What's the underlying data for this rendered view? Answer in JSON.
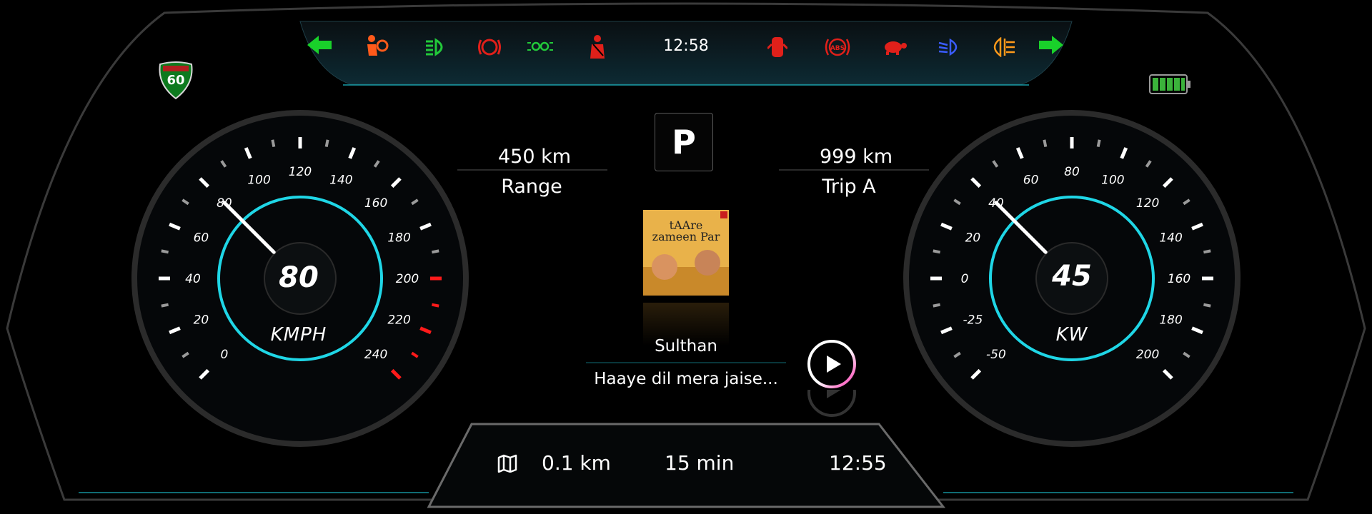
{
  "clock": "12:58",
  "speed_limit_sign": "60",
  "gear": "P",
  "range": {
    "value": "450 km",
    "label": "Range"
  },
  "trip": {
    "value": "999 km",
    "label": "Trip A"
  },
  "media": {
    "album_art_text": "tAAre zameen Par",
    "title": "Sulthan",
    "subtitle": "Haaye dil mera jaise..."
  },
  "speedometer": {
    "value": "80",
    "unit": "KMPH",
    "ticks": [
      "0",
      "20",
      "40",
      "60",
      "80",
      "100",
      "120",
      "140",
      "160",
      "180",
      "200",
      "220",
      "240"
    ],
    "redline_from": 200,
    "needle_value": 80
  },
  "power_meter": {
    "value": "45",
    "unit": "KW",
    "ticks": [
      "-50",
      "-25",
      "0",
      "20",
      "40",
      "60",
      "80",
      "100",
      "120",
      "140",
      "160",
      "180",
      "200"
    ],
    "needle_value": 40
  },
  "navigation": {
    "distance": "0.1 km",
    "duration": "15 min",
    "eta": "12:55"
  },
  "warning_icons": [
    {
      "name": "left-turn-signal-icon",
      "color": "#19d12a"
    },
    {
      "name": "airbag-warning-icon",
      "color": "#ff5a1a"
    },
    {
      "name": "high-beam-auto-icon",
      "color": "#22c93a"
    },
    {
      "name": "parking-brake-icon",
      "color": "#e0201a"
    },
    {
      "name": "position-lights-icon",
      "color": "#22c93a"
    },
    {
      "name": "seatbelt-icon",
      "color": "#e0201a"
    },
    {
      "name": "door-open-icon",
      "color": "#e0201a"
    },
    {
      "name": "abs-icon",
      "color": "#e0201a"
    },
    {
      "name": "tortoise-mode-icon",
      "color": "#e0201a"
    },
    {
      "name": "low-beam-icon",
      "color": "#3a5cff"
    },
    {
      "name": "rear-fog-icon",
      "color": "#ff9a1a"
    },
    {
      "name": "right-turn-signal-icon",
      "color": "#19d12a"
    }
  ],
  "colors": {
    "accent": "#1fd6e6",
    "battery": "#3bb33b",
    "redline": "#ff1a1a"
  }
}
